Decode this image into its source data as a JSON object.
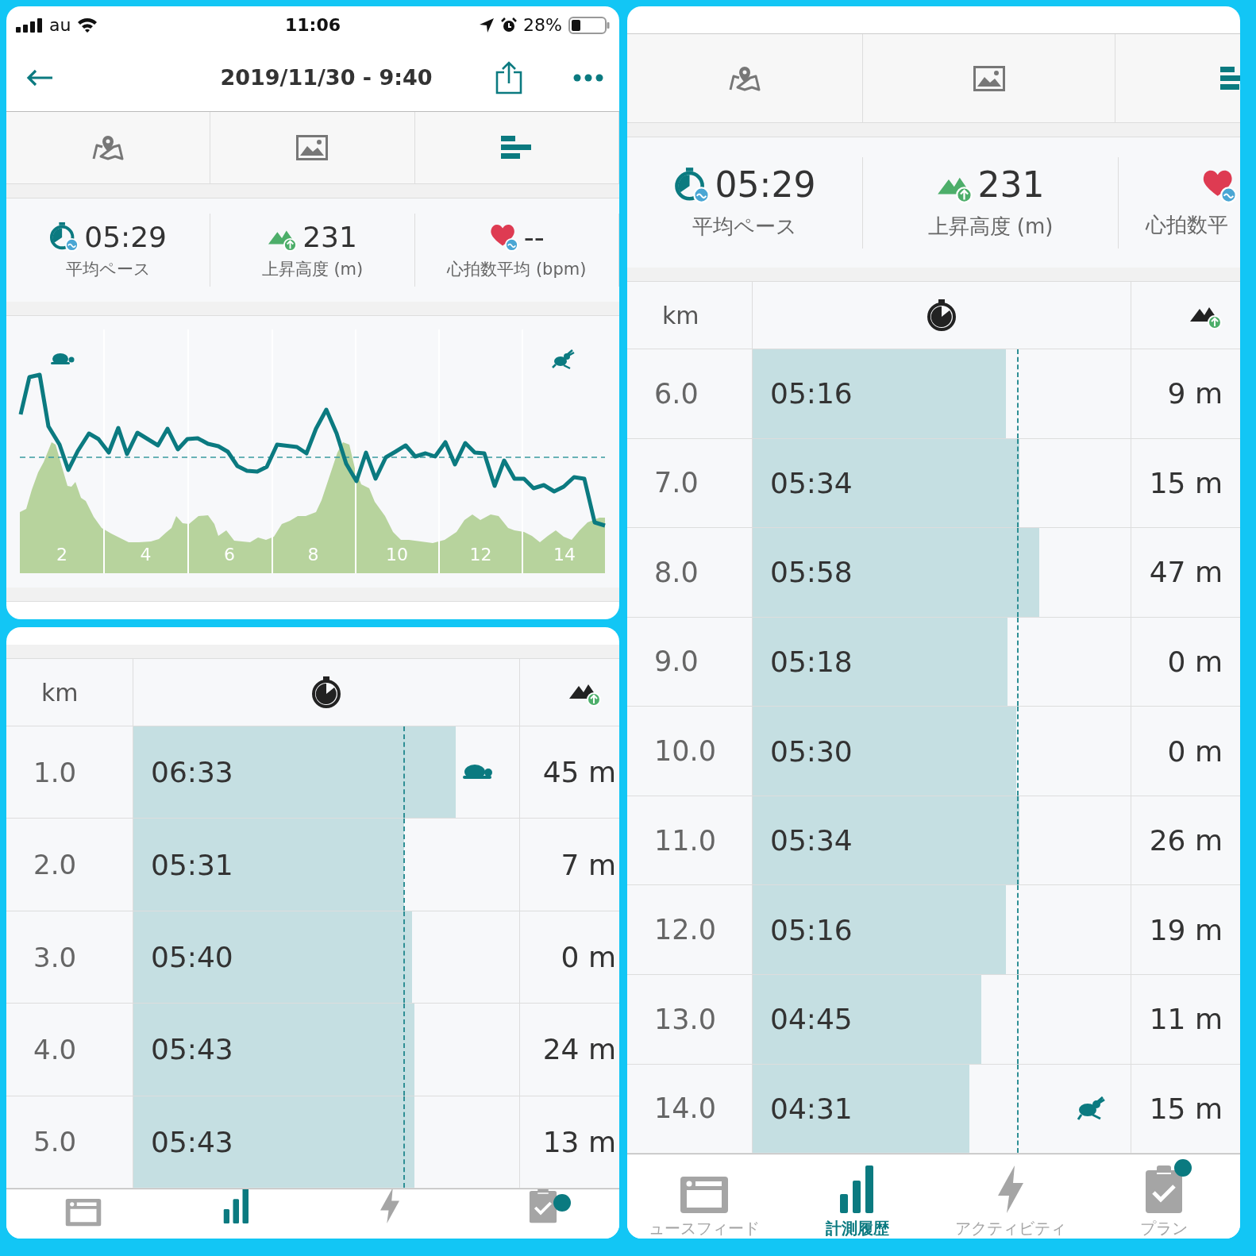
{
  "screens": [
    {
      "status_bar": {
        "carrier": "au",
        "time": "11:06",
        "battery": "28%"
      },
      "header": {
        "title": "2019/11/30 - 9:40"
      },
      "tabs": [
        {
          "kind": "map",
          "selected": false
        },
        {
          "kind": "photo",
          "selected": false
        },
        {
          "kind": "splits",
          "selected": true
        }
      ],
      "stats": [
        {
          "kind": "pace",
          "value": "05:29",
          "label": "平均ペース"
        },
        {
          "kind": "ascent",
          "value": "231",
          "label": "上昇高度 (m)"
        },
        {
          "kind": "heart",
          "value": "--",
          "label": "心拍数平均 (bpm)"
        }
      ],
      "chart": {
        "x_labels": [
          "2",
          "4",
          "6",
          "8",
          "10",
          "12",
          "14"
        ]
      }
    },
    {
      "splits": {
        "km_heading": "km",
        "rows": [
          {
            "kind": "slowest",
            "km": "1.0",
            "pace": "06:33",
            "level": 0.836,
            "ascent": "45 m"
          },
          {
            "kind": "split",
            "km": "2.0",
            "pace": "05:31",
            "level": 0.702,
            "ascent": "7 m"
          },
          {
            "kind": "split",
            "km": "3.0",
            "pace": "05:40",
            "level": 0.723,
            "ascent": "0 m"
          },
          {
            "kind": "split",
            "km": "4.0",
            "pace": "05:43",
            "level": 0.729,
            "ascent": "24 m"
          },
          {
            "kind": "split",
            "km": "5.0",
            "pace": "05:43",
            "level": 0.729,
            "ascent": "13 m"
          }
        ]
      },
      "nav": [
        {
          "kind": "feed",
          "selected": false,
          "badge": false
        },
        {
          "kind": "history",
          "selected": true,
          "badge": false
        },
        {
          "kind": "activity",
          "selected": false,
          "badge": false
        },
        {
          "kind": "plan",
          "selected": false,
          "badge": true
        }
      ]
    },
    {
      "tabs": [
        {
          "kind": "map",
          "selected": false
        },
        {
          "kind": "photo",
          "selected": false
        },
        {
          "kind": "splits",
          "selected": true
        }
      ],
      "stats": [
        {
          "kind": "pace",
          "value": "05:29",
          "label": "平均ペース"
        },
        {
          "kind": "ascent",
          "value": "231",
          "label": "上昇高度 (m)"
        },
        {
          "kind": "heart",
          "label": "心拍数平"
        }
      ],
      "splits": {
        "km_heading": "km",
        "rows": [
          {
            "kind": "split",
            "km": "6.0",
            "pace": "05:16",
            "level": 0.671,
            "ascent": "9 m"
          },
          {
            "kind": "split",
            "km": "7.0",
            "pace": "05:34",
            "level": 0.706,
            "ascent": "15 m"
          },
          {
            "kind": "split",
            "km": "8.0",
            "pace": "05:58",
            "level": 0.759,
            "ascent": "47 m"
          },
          {
            "kind": "split",
            "km": "9.0",
            "pace": "05:18",
            "level": 0.675,
            "ascent": "0 m"
          },
          {
            "kind": "split",
            "km": "10.0",
            "pace": "05:30",
            "level": 0.698,
            "ascent": "0 m"
          },
          {
            "kind": "split",
            "km": "11.0",
            "pace": "05:34",
            "level": 0.706,
            "ascent": "26 m"
          },
          {
            "kind": "split",
            "km": "12.0",
            "pace": "05:16",
            "level": 0.671,
            "ascent": "19 m"
          },
          {
            "kind": "split",
            "km": "13.0",
            "pace": "04:45",
            "level": 0.606,
            "ascent": "11 m"
          },
          {
            "kind": "fastest",
            "km": "14.0",
            "pace": "04:31",
            "level": 0.574,
            "ascent": "15 m"
          }
        ]
      },
      "nav": [
        {
          "kind": "feed",
          "label": "ュースフィード",
          "selected": false,
          "badge": false
        },
        {
          "kind": "history",
          "label": "計測履歴",
          "selected": true,
          "badge": false
        },
        {
          "kind": "activity",
          "label": "アクティビティ",
          "selected": false,
          "badge": false
        },
        {
          "kind": "plan",
          "label": "プラン",
          "selected": false,
          "badge": true
        }
      ]
    }
  ]
}
